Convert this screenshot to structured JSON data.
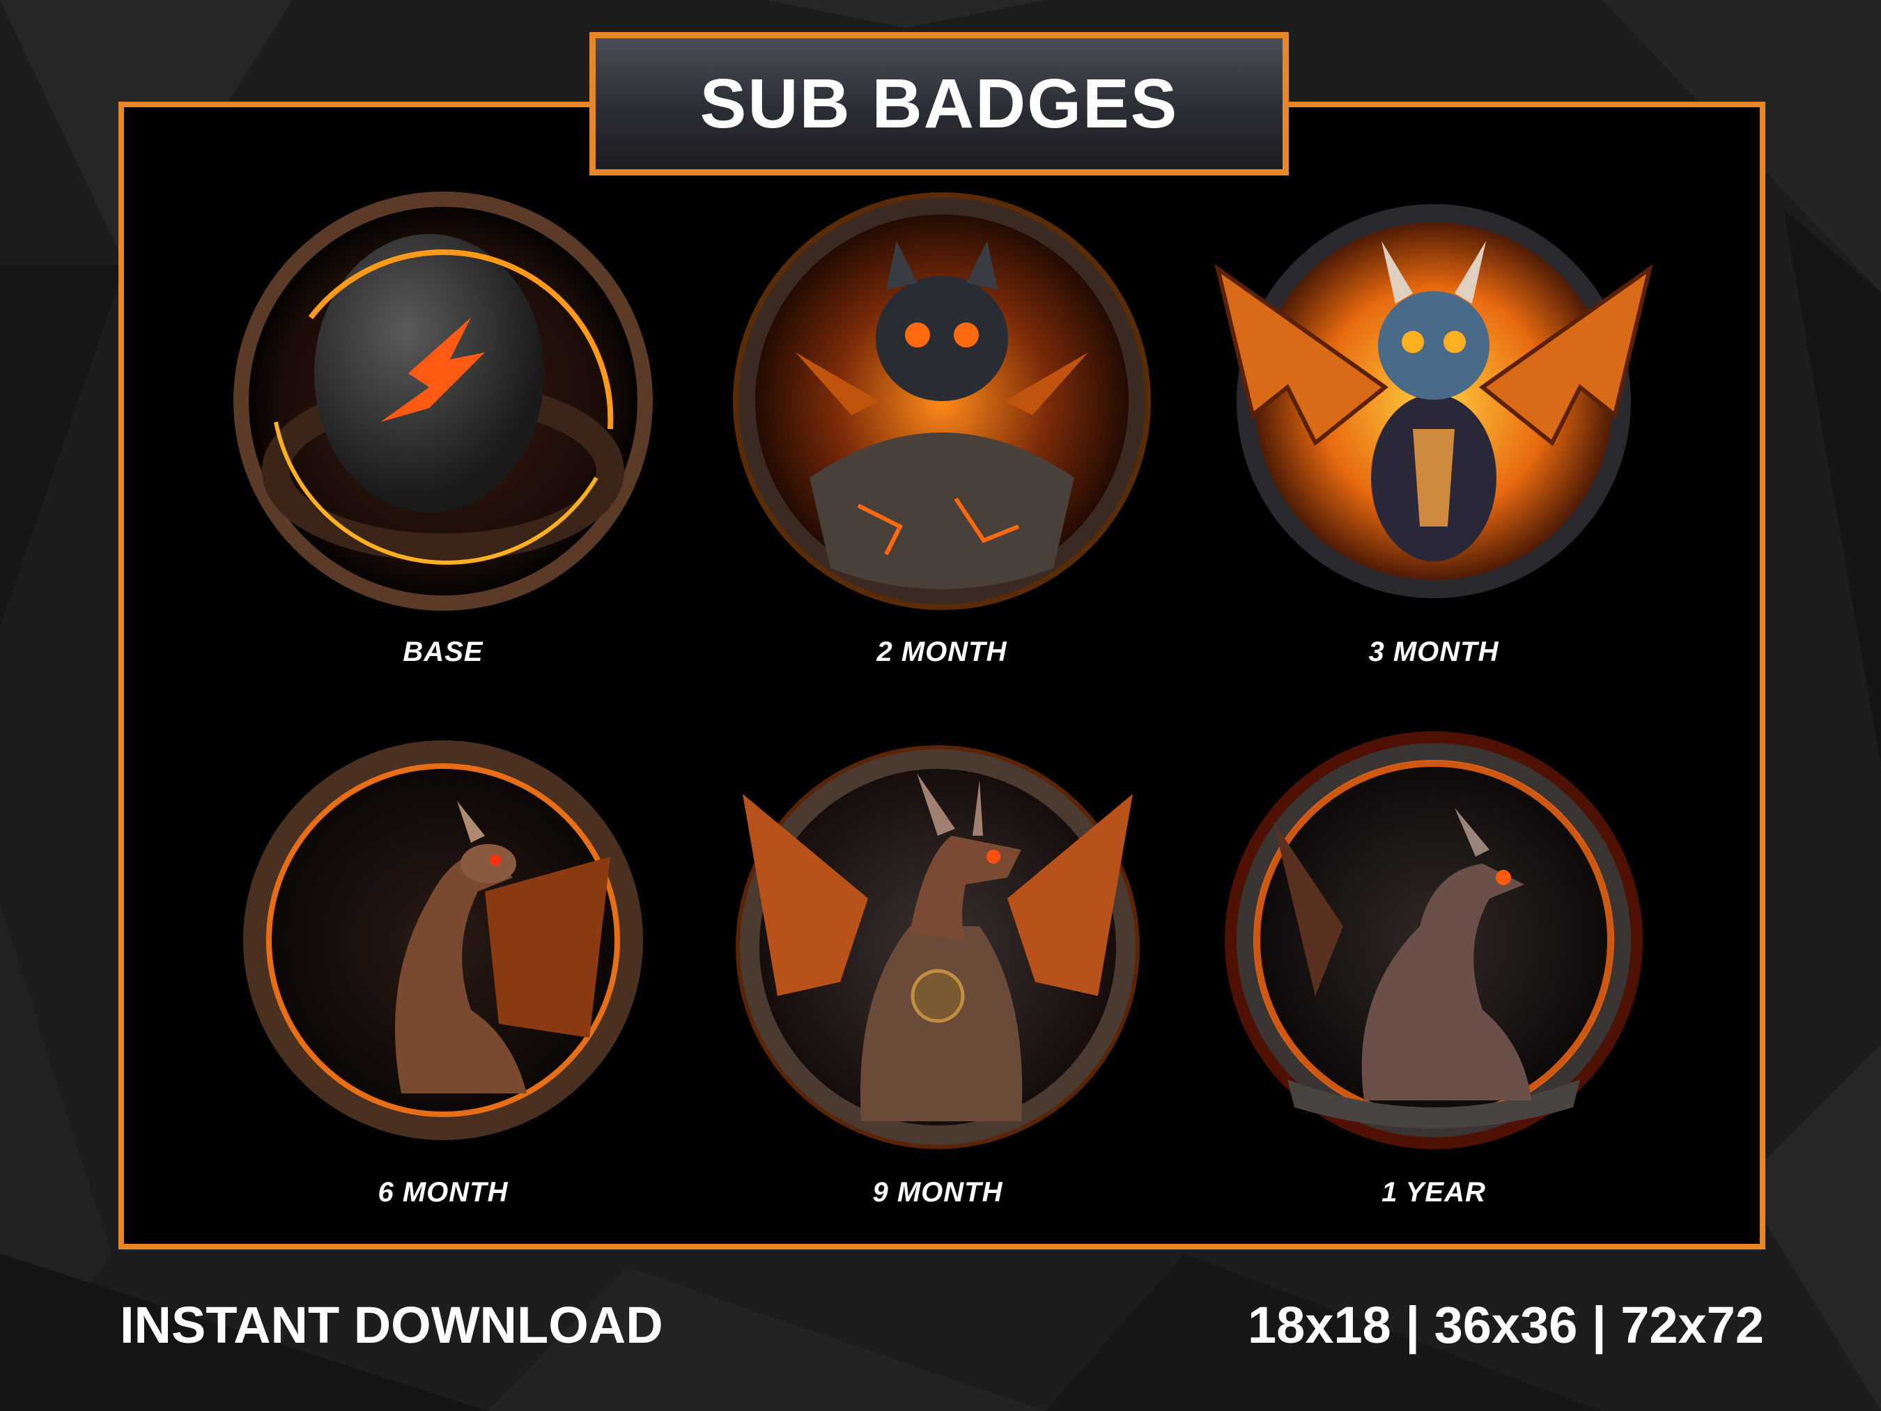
{
  "header": {
    "title": "SUB BADGES"
  },
  "badges": [
    {
      "label": "BASE",
      "icon": "dragon-egg-icon"
    },
    {
      "label": "2 MONTH",
      "icon": "hatching-dragon-icon"
    },
    {
      "label": "3 MONTH",
      "icon": "baby-dragon-wings-icon"
    },
    {
      "label": "6 MONTH",
      "icon": "young-dragon-icon"
    },
    {
      "label": "9 MONTH",
      "icon": "adult-dragon-icon"
    },
    {
      "label": "1 YEAR",
      "icon": "elder-dragon-icon"
    }
  ],
  "footer": {
    "left": "INSTANT DOWNLOAD",
    "right": "18x18 | 36x36 | 72x72"
  },
  "colors": {
    "accent": "#e8862a",
    "background": "#1c1c1c",
    "panel": "#000000"
  }
}
